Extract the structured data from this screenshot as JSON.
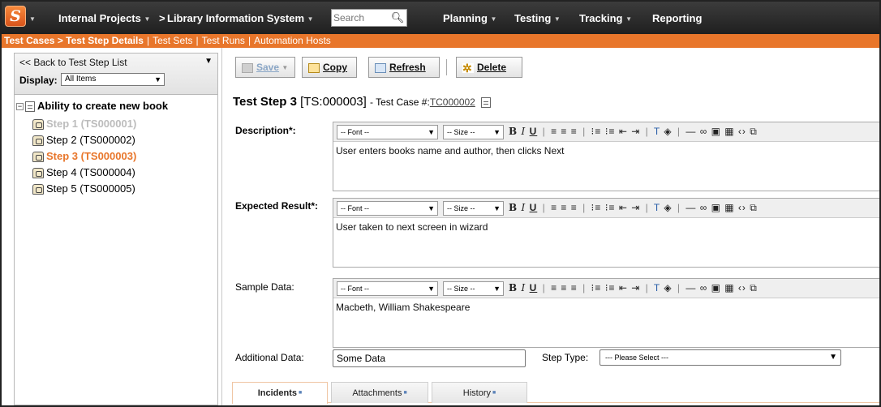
{
  "topnav": {
    "logo": "S",
    "project": "Internal Projects",
    "separator": ">",
    "product": "Library Information System",
    "search_placeholder": "Search",
    "menus": [
      "Planning",
      "Testing",
      "Tracking",
      "Reporting"
    ],
    "colors": {
      "bar": "#2a2a2a",
      "accent": "#e8762b"
    }
  },
  "subnav": {
    "active": "Test Cases > Test Step Details",
    "links": [
      "Test Sets",
      "Test Runs",
      "Automation Hosts"
    ]
  },
  "sidebar": {
    "back_label": "<< Back to Test Step List",
    "display_label": "Display:",
    "display_value": "All Items",
    "tree_root": "Ability to create new book",
    "steps": [
      {
        "label": "Step 1 (TS000001)",
        "state": "disabled"
      },
      {
        "label": "Step 2 (TS000002)",
        "state": "normal"
      },
      {
        "label": "Step 3 (TS000003)",
        "state": "selected"
      },
      {
        "label": "Step 4 (TS000004)",
        "state": "normal"
      },
      {
        "label": "Step 5 (TS000005)",
        "state": "normal"
      }
    ]
  },
  "toolbar": {
    "save": "Save",
    "copy": "Copy",
    "refresh": "Refresh",
    "delete": "Delete"
  },
  "step": {
    "title": "Test Step 3",
    "id": "[TS:000003]",
    "test_case_label": "- Test Case #:",
    "test_case_link": "TC000002"
  },
  "editor": {
    "font_placeholder": "-- Font --",
    "size_placeholder": "-- Size --"
  },
  "fields": {
    "description_label": "Description*:",
    "description_value": "User enters books name and author, then clicks Next",
    "expected_label": "Expected Result*:",
    "expected_value": "User taken to next screen in wizard",
    "sample_label": "Sample Data:",
    "sample_value": "Macbeth, William Shakespeare",
    "additional_label": "Additional Data:",
    "additional_value": "Some Data",
    "step_type_label": "Step Type:",
    "step_type_value": "--- Please Select ---"
  },
  "tabs": [
    {
      "label": "Incidents",
      "active": true
    },
    {
      "label": "Attachments",
      "active": false
    },
    {
      "label": "History",
      "active": false
    }
  ]
}
